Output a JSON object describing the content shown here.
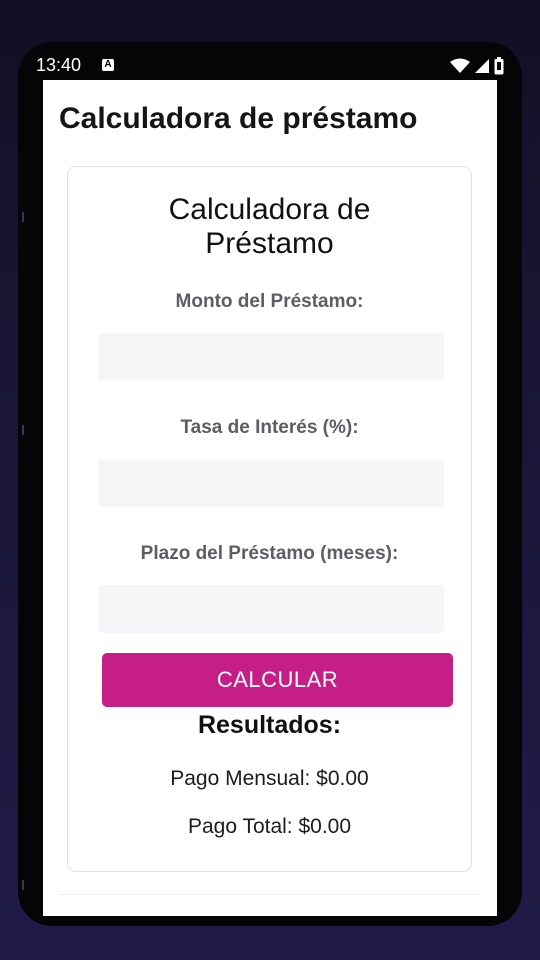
{
  "status_bar": {
    "time": "13:40",
    "notification_icon": "a-notification-icon",
    "icons": [
      "wifi-icon",
      "signal-icon",
      "battery-icon"
    ]
  },
  "app_bar": {
    "title": "Calculadora de préstamo"
  },
  "form": {
    "title_line1": "Calculadora de",
    "title_line2": "Préstamo",
    "amount_label": "Monto del Préstamo:",
    "amount_value": "",
    "rate_label": "Tasa de Interés (%):",
    "rate_value": "",
    "term_label": "Plazo del Préstamo (meses):",
    "term_value": "",
    "calculate_label": "CALCULAR"
  },
  "results": {
    "title": "Resultados:",
    "monthly_payment": "Pago Mensual: $0.00",
    "total_payment": "Pago Total: $0.00"
  },
  "colors": {
    "accent": "#c51e86",
    "background": "#1b1638",
    "input_fill": "#f6f6f9"
  }
}
